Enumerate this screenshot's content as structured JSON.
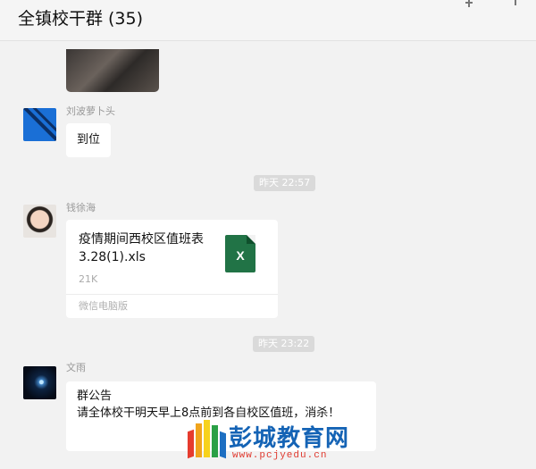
{
  "header": {
    "title": "全镇校干群",
    "count": "(35)",
    "icons": [
      "pin-icon",
      "more-icon"
    ]
  },
  "messages": [
    {
      "sender": "刘波萝卜头",
      "text": "到位"
    },
    {
      "timestamp": "昨天 22:57"
    },
    {
      "sender": "钱徐海",
      "file": {
        "name": "疫情期间西校区值班表3.28(1).xls",
        "size": "21K",
        "source": "微信电脑版",
        "icon_label": "X",
        "icon_color": "#217346"
      }
    },
    {
      "timestamp": "昨天 23:22"
    },
    {
      "sender": "文雨",
      "notice": {
        "title": "群公告",
        "body": "请全体校干明天早上8点前到各自校区值班，消杀！"
      }
    }
  ],
  "watermark": {
    "title": "彭城教育网",
    "url": "www.pcjyedu.cn"
  }
}
